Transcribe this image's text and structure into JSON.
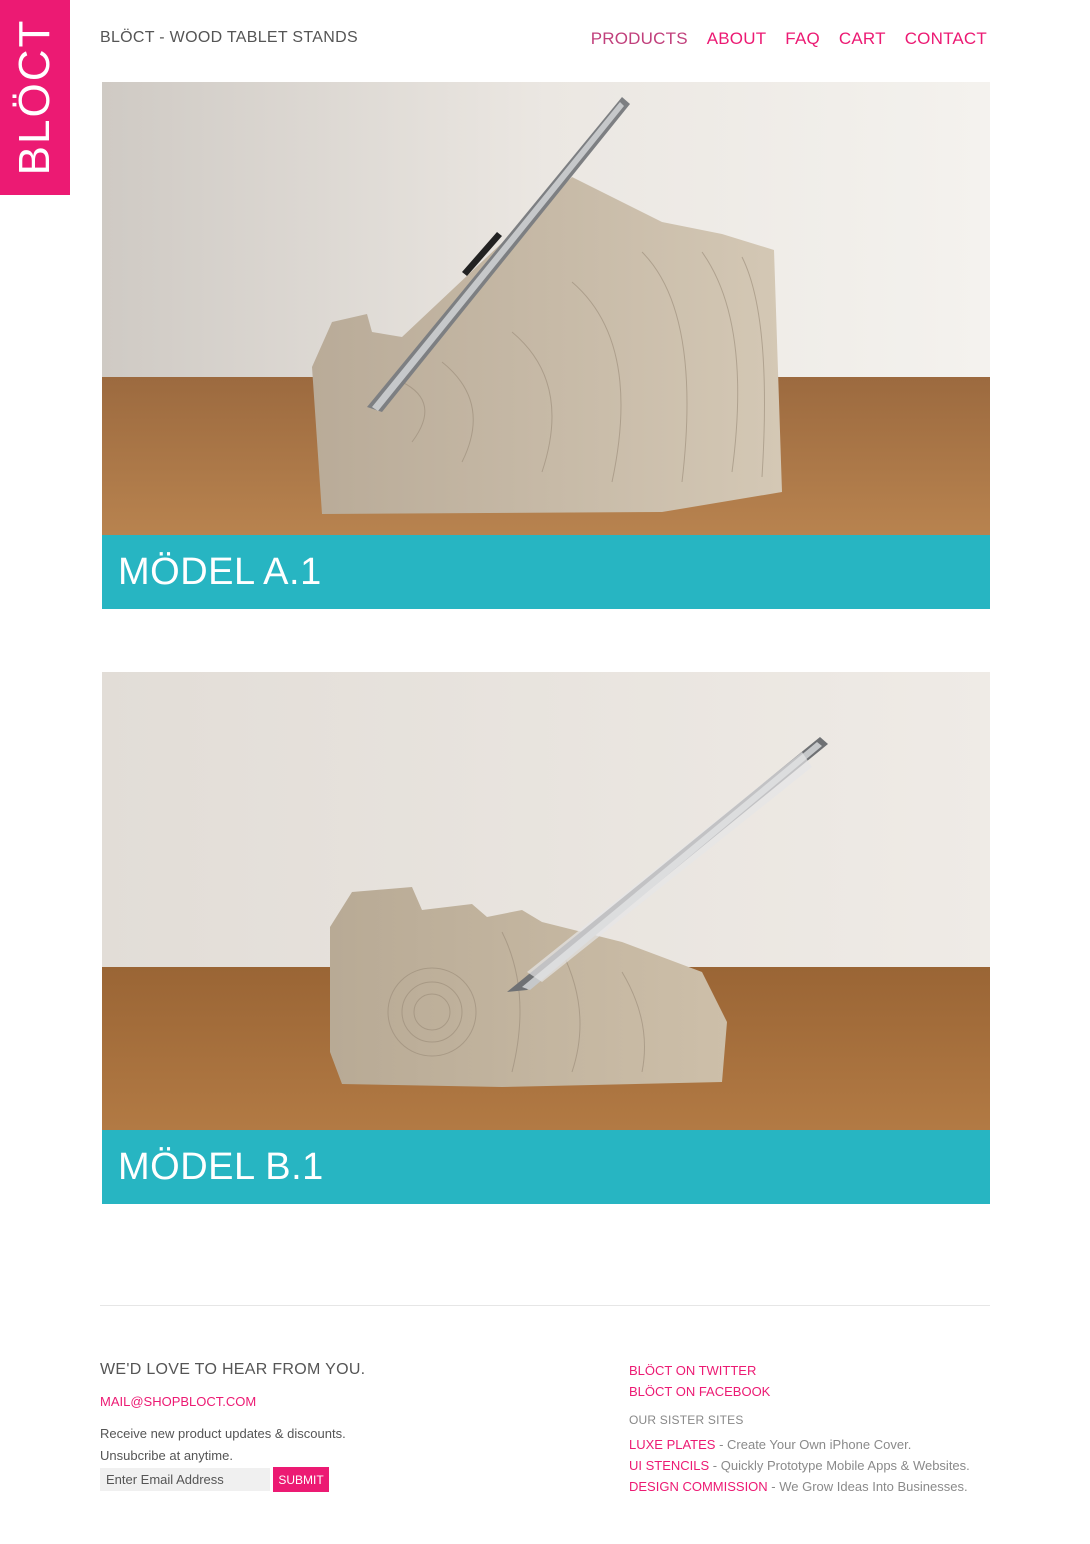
{
  "brand": {
    "logo_text": "BLÖCT",
    "color": "#ec1a73"
  },
  "header": {
    "title": "BLÖCT - WOOD TABLET STANDS",
    "nav": [
      {
        "label": "PRODUCTS",
        "active": true
      },
      {
        "label": "ABOUT"
      },
      {
        "label": "FAQ"
      },
      {
        "label": "CART"
      },
      {
        "label": "CONTACT"
      }
    ]
  },
  "products": [
    {
      "name": "MÖDEL A.1",
      "caption_color": "#27b5c2"
    },
    {
      "name": "MÖDEL B.1",
      "caption_color": "#27b5c2"
    }
  ],
  "footer": {
    "heading": "WE'D LOVE TO HEAR FROM YOU.",
    "email": "MAIL@SHOPBLOCT.COM",
    "newsletter_line1": "Receive new product updates & discounts.",
    "newsletter_line2": "Unsubcribe at anytime.",
    "email_placeholder": "Enter Email Address",
    "submit_label": "SUBMIT",
    "social": [
      {
        "label": "BLÖCT ON TWITTER"
      },
      {
        "label": "BLÖCT ON FACEBOOK"
      }
    ],
    "sister_heading": "OUR SISTER SITES",
    "sister_sites": [
      {
        "name": "LUXE PLATES",
        "desc": " - Create Your Own iPhone Cover."
      },
      {
        "name": "UI STENCILS",
        "desc": " - Quickly Prototype Mobile Apps & Websites."
      },
      {
        "name": "DESIGN COMMISSION",
        "desc": " - We Grow Ideas Into Businesses."
      }
    ]
  }
}
